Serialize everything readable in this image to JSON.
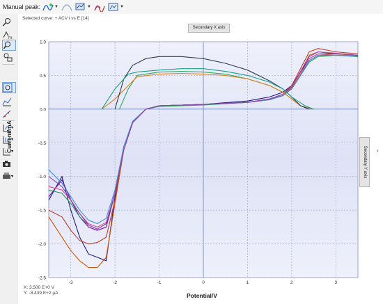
{
  "toolbar": {
    "manual_peak_label": "Manual peak:",
    "icons": [
      "peak-search-icon",
      "peak-shape-icon",
      "baseline-icon",
      "curve-settings-icon",
      "peak-overlay-icon",
      "export-icon"
    ]
  },
  "selected_curve": "Selected curve:  + ACV i vs E [14]",
  "secondary_x_axis": "Secondary X axis",
  "secondary_y_axis": "Secondary Y axis",
  "coords": {
    "x": "X: 3.500 E+0 V",
    "y": "Y: -8.439 E+2 μA"
  },
  "chart_data": {
    "type": "line",
    "xlabel": "Potential/V",
    "ylabel": "Current/mA",
    "xlim": [
      -3.5,
      3.5
    ],
    "ylim": [
      -2.5,
      1.0
    ],
    "x_ticks": [
      "-3",
      "-2",
      "-1",
      "0",
      "1",
      "2",
      "3"
    ],
    "y_ticks": [
      "1.0",
      "0.5",
      "0.0",
      "-0.5",
      "-1.0",
      "-1.5",
      "-2.0",
      "-2.5"
    ],
    "grid": true,
    "colors": [
      "#1a1a8c",
      "#6a0dad",
      "#c0392b",
      "#1f9f4a",
      "#d35400",
      "#e74c8c",
      "#3b8fd6",
      "#8e44ad",
      "#27ae60",
      "#e67e22",
      "#2c3e50",
      "#16a085",
      "#b7950b",
      "#7f8c8d"
    ],
    "series": [
      {
        "x": [
          -3.5,
          -3.2,
          -3.0,
          -2.8,
          -2.6,
          -2.4,
          -2.2,
          -2.0,
          -1.8,
          -1.6,
          -1.3,
          -1.0,
          0,
          1.0,
          1.5,
          1.8,
          2.0,
          2.2,
          2.4,
          2.6,
          3.0,
          3.5
        ],
        "y": [
          -1.35,
          -1.0,
          -1.5,
          -1.9,
          -2.15,
          -2.2,
          -2.25,
          -1.3,
          -0.6,
          -0.2,
          0.0,
          0.05,
          0.07,
          0.12,
          0.18,
          0.25,
          0.35,
          0.55,
          0.75,
          0.82,
          0.82,
          0.8
        ]
      },
      {
        "x": [
          -3.5,
          -3.2,
          -3.0,
          -2.8,
          -2.6,
          -2.4,
          -2.2,
          -2.0,
          -1.8,
          -1.6,
          -1.3,
          -1.0,
          0,
          1.0,
          1.5,
          1.8,
          2.0,
          2.2,
          2.4,
          2.6,
          3.0,
          3.5
        ],
        "y": [
          -1.3,
          -1.05,
          -1.35,
          -1.6,
          -1.75,
          -1.8,
          -1.75,
          -1.25,
          -0.6,
          -0.2,
          0.0,
          0.05,
          0.07,
          0.1,
          0.15,
          0.2,
          0.3,
          0.5,
          0.72,
          0.8,
          0.8,
          0.78
        ]
      },
      {
        "x": [
          -3.5,
          -3.2,
          -3.0,
          -2.8,
          -2.6,
          -2.4,
          -2.2,
          -2.0,
          -1.8,
          -1.6,
          -1.3,
          -1.0,
          0,
          1.0,
          1.5,
          1.8,
          2.0,
          2.2,
          2.4,
          2.6,
          3.0,
          3.5
        ],
        "y": [
          -1.5,
          -1.6,
          -1.8,
          -1.95,
          -2.0,
          -1.98,
          -1.9,
          -1.35,
          -0.6,
          -0.2,
          0.0,
          0.05,
          0.07,
          0.1,
          0.15,
          0.22,
          0.35,
          0.6,
          0.85,
          0.9,
          0.85,
          0.82
        ]
      },
      {
        "x": [
          -3.5,
          -3.2,
          -3.0,
          -2.8,
          -2.6,
          -2.4,
          -2.2,
          -2.0,
          -1.8,
          -1.6,
          -1.3,
          -1.0,
          0,
          1.0,
          1.5,
          1.8,
          2.0,
          2.2,
          2.4,
          2.6,
          3.0,
          3.5
        ],
        "y": [
          -1.2,
          -1.25,
          -1.4,
          -1.6,
          -1.72,
          -1.78,
          -1.7,
          -1.25,
          -0.6,
          -0.2,
          0.0,
          0.04,
          0.06,
          0.1,
          0.14,
          0.2,
          0.3,
          0.5,
          0.7,
          0.78,
          0.8,
          0.79
        ]
      },
      {
        "x": [
          -3.5,
          -3.2,
          -3.0,
          -2.8,
          -2.6,
          -2.4,
          -2.2,
          -2.0,
          -1.8,
          -1.6,
          -1.3,
          -1.0,
          0,
          1.0,
          1.5,
          1.8,
          2.0,
          2.2,
          2.4,
          2.6,
          3.0,
          3.5
        ],
        "y": [
          -1.6,
          -1.9,
          -2.1,
          -2.25,
          -2.35,
          -2.35,
          -2.2,
          -1.4,
          -0.6,
          -0.2,
          0.0,
          0.05,
          0.07,
          0.1,
          0.14,
          0.2,
          0.32,
          0.55,
          0.8,
          0.85,
          0.82,
          0.8
        ]
      },
      {
        "x": [
          -3.5,
          -3.2,
          -3.0,
          -2.8,
          -2.6,
          -2.4,
          -2.2,
          -2.0,
          -1.8,
          -1.6,
          -1.3,
          -1.0,
          0,
          1.0,
          1.5,
          1.8,
          2.0,
          2.2,
          2.4,
          2.6,
          3.0,
          3.5
        ],
        "y": [
          -1.15,
          -1.2,
          -1.35,
          -1.55,
          -1.7,
          -1.75,
          -1.68,
          -1.25,
          -0.6,
          -0.2,
          0.0,
          0.05,
          0.07,
          0.1,
          0.15,
          0.2,
          0.3,
          0.52,
          0.75,
          0.82,
          0.8,
          0.8
        ]
      },
      {
        "x": [
          -3.5,
          -3.2,
          -3.0,
          -2.8,
          -2.6,
          -2.4,
          -2.2,
          -2.0,
          -1.8,
          -1.6,
          -1.3,
          -1.0,
          0,
          1.0,
          1.5,
          1.8,
          2.0,
          2.2,
          2.4,
          2.6,
          3.0,
          3.5
        ],
        "y": [
          -0.9,
          -1.1,
          -1.3,
          -1.5,
          -1.65,
          -1.7,
          -1.62,
          -1.2,
          -0.55,
          -0.18,
          0.0,
          0.05,
          0.07,
          0.1,
          0.14,
          0.2,
          0.3,
          0.5,
          0.72,
          0.8,
          0.8,
          0.78
        ]
      },
      {
        "x": [
          -3.5,
          -3.2,
          -3.0,
          -2.8,
          -2.6,
          -2.4,
          -2.2,
          -2.0,
          -1.8,
          -1.6,
          -1.3,
          -1.0,
          0,
          1.0,
          1.5,
          1.8,
          2.0,
          2.2,
          2.4,
          2.6,
          3.0,
          3.5
        ],
        "y": [
          -1.0,
          -1.15,
          -1.35,
          -1.55,
          -1.72,
          -1.78,
          -1.7,
          -1.25,
          -0.6,
          -0.2,
          0.0,
          0.05,
          0.07,
          0.1,
          0.15,
          0.22,
          0.33,
          0.56,
          0.78,
          0.85,
          0.83,
          0.8
        ]
      },
      {
        "x": [
          -1.9,
          -1.7,
          -1.5,
          -1.0,
          -0.5,
          0,
          0.5,
          1.0,
          1.5,
          1.8,
          2.0,
          2.2,
          2.4
        ],
        "y": [
          0.0,
          0.3,
          0.5,
          0.55,
          0.56,
          0.55,
          0.52,
          0.45,
          0.35,
          0.25,
          0.15,
          0.05,
          0.0
        ]
      },
      {
        "x": [
          -2.3,
          -2.0,
          -1.7,
          -1.5,
          -1.0,
          -0.5,
          0,
          0.5,
          1.0,
          1.5,
          1.8,
          2.0,
          2.2,
          2.5
        ],
        "y": [
          0.0,
          0.15,
          0.35,
          0.48,
          0.52,
          0.53,
          0.52,
          0.5,
          0.45,
          0.35,
          0.25,
          0.15,
          0.05,
          0.0
        ]
      },
      {
        "x": [
          -2.0,
          -1.8,
          -1.6,
          -1.3,
          -1.0,
          -0.5,
          0,
          0.5,
          1.0,
          1.5,
          1.8,
          2.0,
          2.2,
          2.4
        ],
        "y": [
          0.0,
          0.45,
          0.65,
          0.75,
          0.78,
          0.78,
          0.75,
          0.68,
          0.58,
          0.42,
          0.3,
          0.18,
          0.05,
          0.0
        ]
      },
      {
        "x": [
          -2.3,
          -2.0,
          -1.7,
          -1.5,
          -1.0,
          -0.5,
          0,
          0.5,
          1.0,
          1.5,
          1.8,
          2.0,
          2.3,
          2.5
        ],
        "y": [
          0.0,
          0.3,
          0.52,
          0.55,
          0.58,
          0.6,
          0.6,
          0.56,
          0.5,
          0.4,
          0.3,
          0.18,
          0.05,
          0.0
        ]
      }
    ]
  }
}
